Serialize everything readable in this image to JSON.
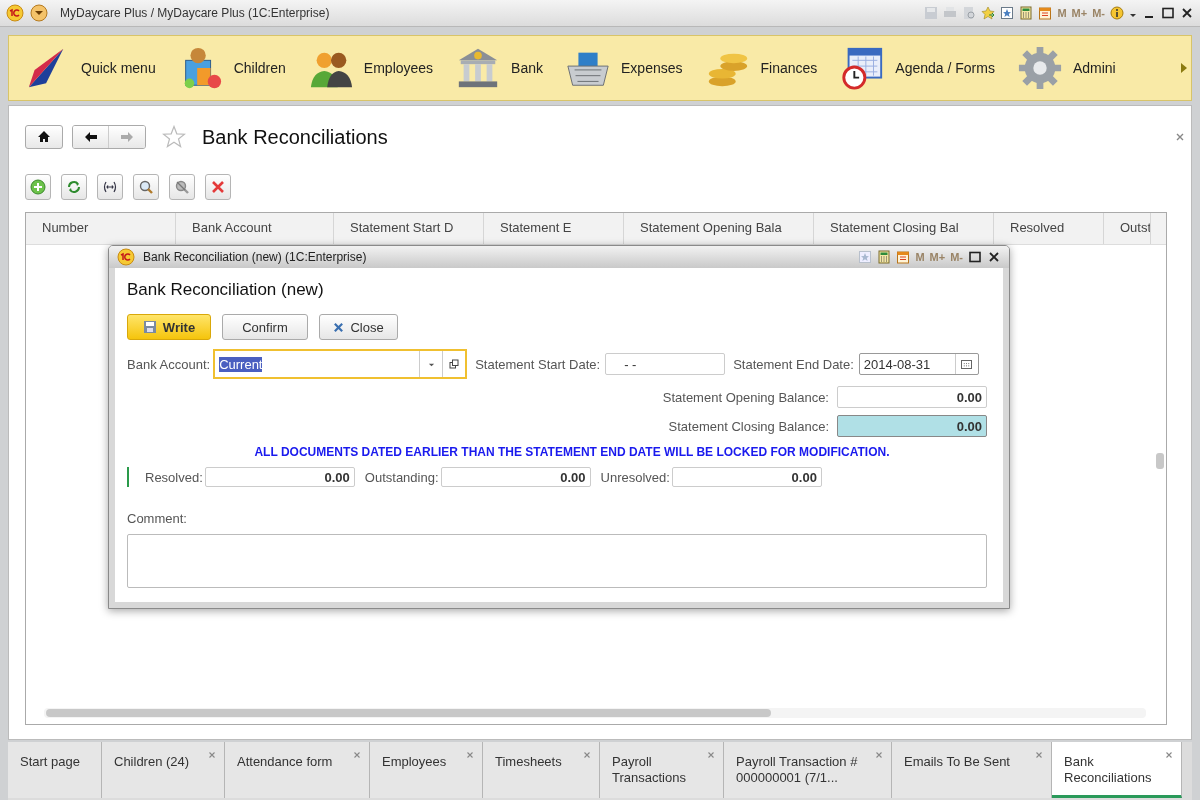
{
  "window": {
    "title": "MyDaycare Plus / MyDaycare Plus  (1C:Enterprise)",
    "memory_buttons": [
      {
        "label": "M",
        "disabled": true
      },
      {
        "label": "M+",
        "disabled": true
      },
      {
        "label": "M-",
        "disabled": true
      }
    ]
  },
  "sections": [
    {
      "label": "Quick menu"
    },
    {
      "label": "Children"
    },
    {
      "label": "Employees"
    },
    {
      "label": "Bank"
    },
    {
      "label": "Expenses"
    },
    {
      "label": "Finances"
    },
    {
      "label": "Agenda / Forms"
    },
    {
      "label": "Admini"
    }
  ],
  "page": {
    "title": "Bank Reconciliations"
  },
  "table": {
    "columns": [
      "Number",
      "Bank Account",
      "Statement Start D",
      "Statement E",
      "Statement Opening Bala",
      "Statement Closing Bal",
      "Resolved",
      "Outst"
    ]
  },
  "dialog": {
    "title": "Bank Reconciliation (new)  (1C:Enterprise)",
    "memory_buttons": [
      {
        "label": "M",
        "disabled": true
      },
      {
        "label": "M+",
        "disabled": true
      },
      {
        "label": "M-",
        "disabled": true
      }
    ],
    "heading": "Bank Reconciliation (new)",
    "buttons": [
      {
        "label": "Write",
        "kind": "default"
      },
      {
        "label": "Confirm",
        "kind": "plain"
      },
      {
        "label": "Close",
        "kind": "close"
      }
    ],
    "bank_account": {
      "label": "Bank Account:",
      "value": "Current",
      "focused": true,
      "value_selected": true
    },
    "start_date": {
      "label": "Statement Start Date:",
      "value": "-  -"
    },
    "end_date": {
      "label": "Statement End Date:",
      "value": "2014-08-31"
    },
    "balances": [
      {
        "label": "Statement Opening Balance:",
        "value": "0.00",
        "highlighted": false
      },
      {
        "label": "Statement Closing Balance:",
        "value": "0.00",
        "highlighted": true
      }
    ],
    "notice": "ALL DOCUMENTS DATED EARLIER THAN THE STATEMENT END DATE WILL BE LOCKED FOR MODIFICATION.",
    "totals": [
      {
        "label": "Resolved:",
        "value": "0.00"
      },
      {
        "label": "Outstanding:",
        "value": "0.00"
      },
      {
        "label": "Unresolved:",
        "value": "0.00"
      }
    ],
    "comment": {
      "label": "Comment:"
    }
  },
  "tabs": [
    {
      "label": "Start page",
      "selected": false,
      "closable": false
    },
    {
      "label": "Children (24)",
      "selected": false,
      "closable": true
    },
    {
      "label": "Attendance form",
      "selected": false,
      "closable": true
    },
    {
      "label": "Employees",
      "selected": false,
      "closable": true
    },
    {
      "label": "Timesheets",
      "selected": false,
      "closable": true
    },
    {
      "label": "Payroll Transactions",
      "selected": false,
      "closable": true
    },
    {
      "label": "Payroll Transaction # 000000001 (7/1...",
      "selected": false,
      "closable": true
    },
    {
      "label": "Emails To Be Sent",
      "selected": false,
      "closable": true
    },
    {
      "label": "Bank Reconciliations",
      "selected": true,
      "closable": true
    }
  ]
}
